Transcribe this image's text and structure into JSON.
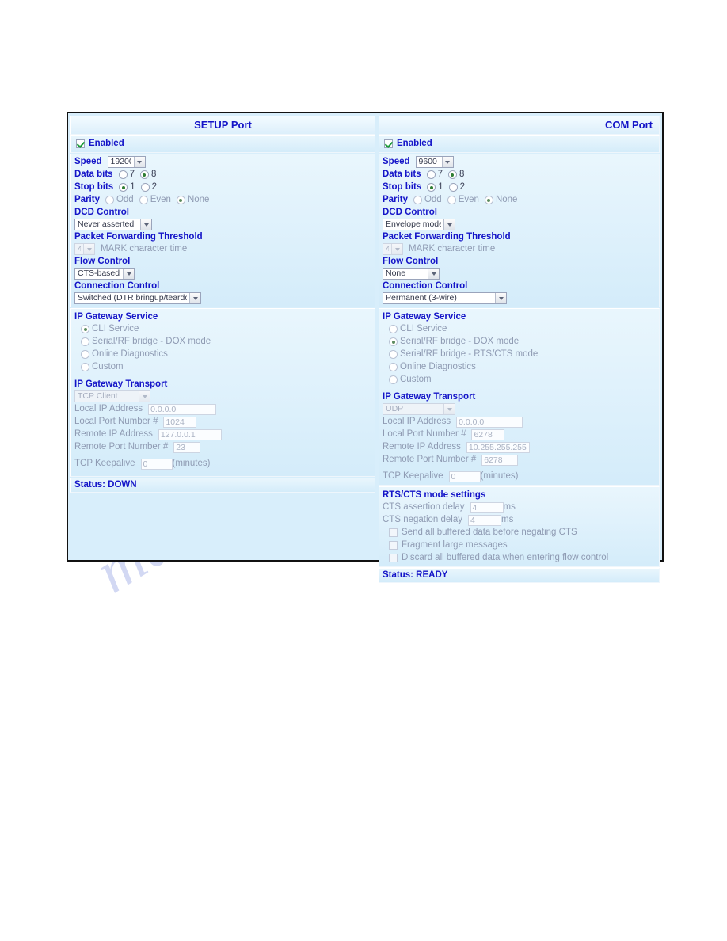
{
  "watermark": {
    "text": "manualshive.com"
  },
  "ports": [
    {
      "id": "setup",
      "title": "SETUP Port",
      "title_align": "center",
      "enabled_label": "Enabled",
      "enabled_checked": true,
      "serial": {
        "speed_label": "Speed",
        "speed_value": "19200",
        "data_bits_label": "Data bits",
        "data_bits_options": [
          "7",
          "8"
        ],
        "data_bits_selected": "8",
        "stop_bits_label": "Stop bits",
        "stop_bits_options": [
          "1",
          "2"
        ],
        "stop_bits_selected": "1",
        "parity_label": "Parity",
        "parity_options": [
          "Odd",
          "Even",
          "None"
        ],
        "parity_selected": "None",
        "dcd_control_label": "DCD Control",
        "dcd_control_value": "Never asserted",
        "packet_threshold_label": "Packet Forwarding Threshold",
        "packet_threshold_value": "4",
        "packet_threshold_suffix": "MARK character time",
        "flow_control_label": "Flow Control",
        "flow_control_value": "CTS-based",
        "connection_control_label": "Connection Control",
        "connection_control_value": "Switched (DTR bringup/teardown)"
      },
      "gateway": {
        "service_label": "IP Gateway Service",
        "service_options": [
          "CLI Service",
          "Serial/RF bridge - DOX mode",
          "Online Diagnostics",
          "Custom"
        ],
        "service_selected": "CLI Service",
        "transport_label": "IP Gateway Transport",
        "transport_value": "TCP Client",
        "local_ip_label": "Local IP Address",
        "local_ip_value": "0.0.0.0",
        "local_port_label": "Local Port Number #",
        "local_port_value": "1024",
        "remote_ip_label": "Remote IP Address",
        "remote_ip_value": "127.0.0.1",
        "remote_port_label": "Remote Port Number #",
        "remote_port_value": "23",
        "keepalive_label": "TCP Keepalive",
        "keepalive_value": "0",
        "keepalive_units": "(minutes)"
      },
      "rtscts": null,
      "status_label": "Status: DOWN"
    },
    {
      "id": "com",
      "title": "COM Port",
      "title_align": "right",
      "enabled_label": "Enabled",
      "enabled_checked": true,
      "serial": {
        "speed_label": "Speed",
        "speed_value": "9600",
        "data_bits_label": "Data bits",
        "data_bits_options": [
          "7",
          "8"
        ],
        "data_bits_selected": "8",
        "stop_bits_label": "Stop bits",
        "stop_bits_options": [
          "1",
          "2"
        ],
        "stop_bits_selected": "1",
        "parity_label": "Parity",
        "parity_options": [
          "Odd",
          "Even",
          "None"
        ],
        "parity_selected": "None",
        "dcd_control_label": "DCD Control",
        "dcd_control_value": "Envelope mode",
        "packet_threshold_label": "Packet Forwarding Threshold",
        "packet_threshold_value": "4",
        "packet_threshold_suffix": "MARK character time",
        "flow_control_label": "Flow Control",
        "flow_control_value": "None",
        "connection_control_label": "Connection Control",
        "connection_control_value": "Permanent (3-wire)"
      },
      "gateway": {
        "service_label": "IP Gateway Service",
        "service_options": [
          "CLI Service",
          "Serial/RF bridge - DOX mode",
          "Serial/RF bridge - RTS/CTS mode",
          "Online Diagnostics",
          "Custom"
        ],
        "service_selected": "Serial/RF bridge - DOX mode",
        "transport_label": "IP Gateway Transport",
        "transport_value": "UDP",
        "local_ip_label": "Local IP Address",
        "local_ip_value": "0.0.0.0",
        "local_port_label": "Local Port Number #",
        "local_port_value": "6278",
        "remote_ip_label": "Remote IP Address",
        "remote_ip_value": "10.255.255.255",
        "remote_port_label": "Remote Port Number #",
        "remote_port_value": "6278",
        "keepalive_label": "TCP Keepalive",
        "keepalive_value": "0",
        "keepalive_units": "(minutes)"
      },
      "rtscts": {
        "heading": "RTS/CTS mode settings",
        "assertion_label": "CTS assertion delay",
        "assertion_value": "4",
        "assertion_units": "ms",
        "negation_label": "CTS negation delay",
        "negation_value": "4",
        "negation_units": "ms",
        "checkboxes": [
          {
            "label": "Send all buffered data before negating CTS",
            "checked": false
          },
          {
            "label": "Fragment large messages",
            "checked": false
          },
          {
            "label": "Discard all buffered data when entering flow control",
            "checked": false
          }
        ]
      },
      "status_label": "Status: READY"
    }
  ],
  "colors": {
    "heading_blue": "#1414c8",
    "panel_bg": "#d8eefb",
    "disabled_text": "#8f9bb3",
    "check_green": "#1d9c3a"
  }
}
